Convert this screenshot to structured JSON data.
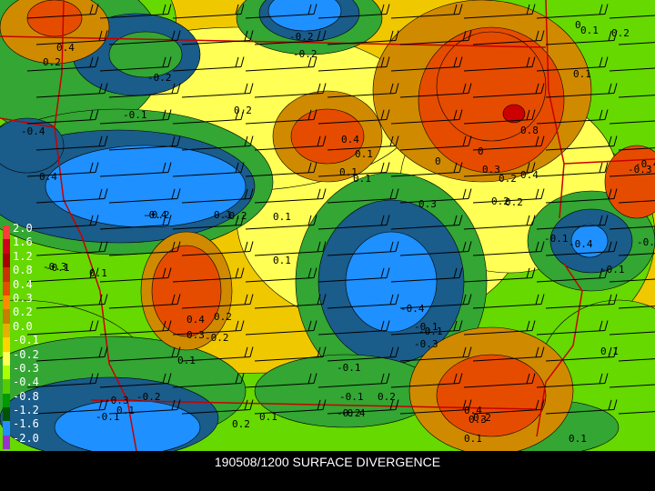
{
  "caption": "190508/1200 SURFACE DIVERGENCE",
  "legend": {
    "labels": [
      "2.0",
      "1.6",
      "1.2",
      "0.8",
      "0.4",
      "0.3",
      "0.2",
      "0.0",
      "-0.1",
      "-0.2",
      "-0.3",
      "-0.4",
      "-0.8",
      "-1.2",
      "-1.6",
      "-2.0"
    ],
    "colors": [
      "#ff3b3b",
      "#d0001a",
      "#a80000",
      "#c83200",
      "#e64c00",
      "#ff8c00",
      "#c87d00",
      "#e6b000",
      "#ffd400",
      "#ffff55",
      "#aaff00",
      "#55cc00",
      "#009900",
      "#005500",
      "#1e90ff",
      "#9932cc"
    ]
  },
  "fill_colors": {
    "strong_convergence": "#1e90ff",
    "convergence": "#1a5c8a",
    "weak_convergence": "#33a633",
    "neutral": "#66d900",
    "weak_divergence": "#ffff55",
    "divergence": "#f0c800",
    "moderate_divergence": "#d08a00",
    "strong_divergence": "#e64c00",
    "very_strong": "#cc0000",
    "boundary": "#c80000"
  },
  "contour_labels": [
    "0.4",
    "-0.2",
    "-0.2",
    "0",
    "0.2",
    "-0.2",
    "0.2",
    "0.4",
    "0.1",
    "0.1",
    "0.1",
    "-0.2",
    "0",
    "0.8",
    "0.4",
    "0.1",
    "0.1",
    "0",
    "-0.4",
    "-0.3",
    "-0.2",
    "0.2",
    "0.4",
    "0.3",
    "0.2",
    "0.1",
    "-0.1",
    "-0.4",
    "-0.3",
    "0.2",
    "0.1",
    "-0.1",
    "-0.3",
    "-0.4",
    "-0.1",
    "0.3",
    "0.4",
    "-0.2",
    "0.1",
    "-0.1",
    "0.2",
    "0.1",
    "-0.1",
    "-0.4",
    "0.2",
    "-0.2",
    "0.1",
    "0.1",
    "-0.1",
    "-0.3",
    "-0.2",
    "0.1",
    "0.2",
    "0.3",
    "0.4",
    "0.1",
    "-0.1",
    "-0.4",
    "0.1",
    "0.2",
    "-0.1",
    "-0.3",
    "-0.4",
    "0.3",
    "0.2",
    "0.1",
    "-0.1"
  ]
}
